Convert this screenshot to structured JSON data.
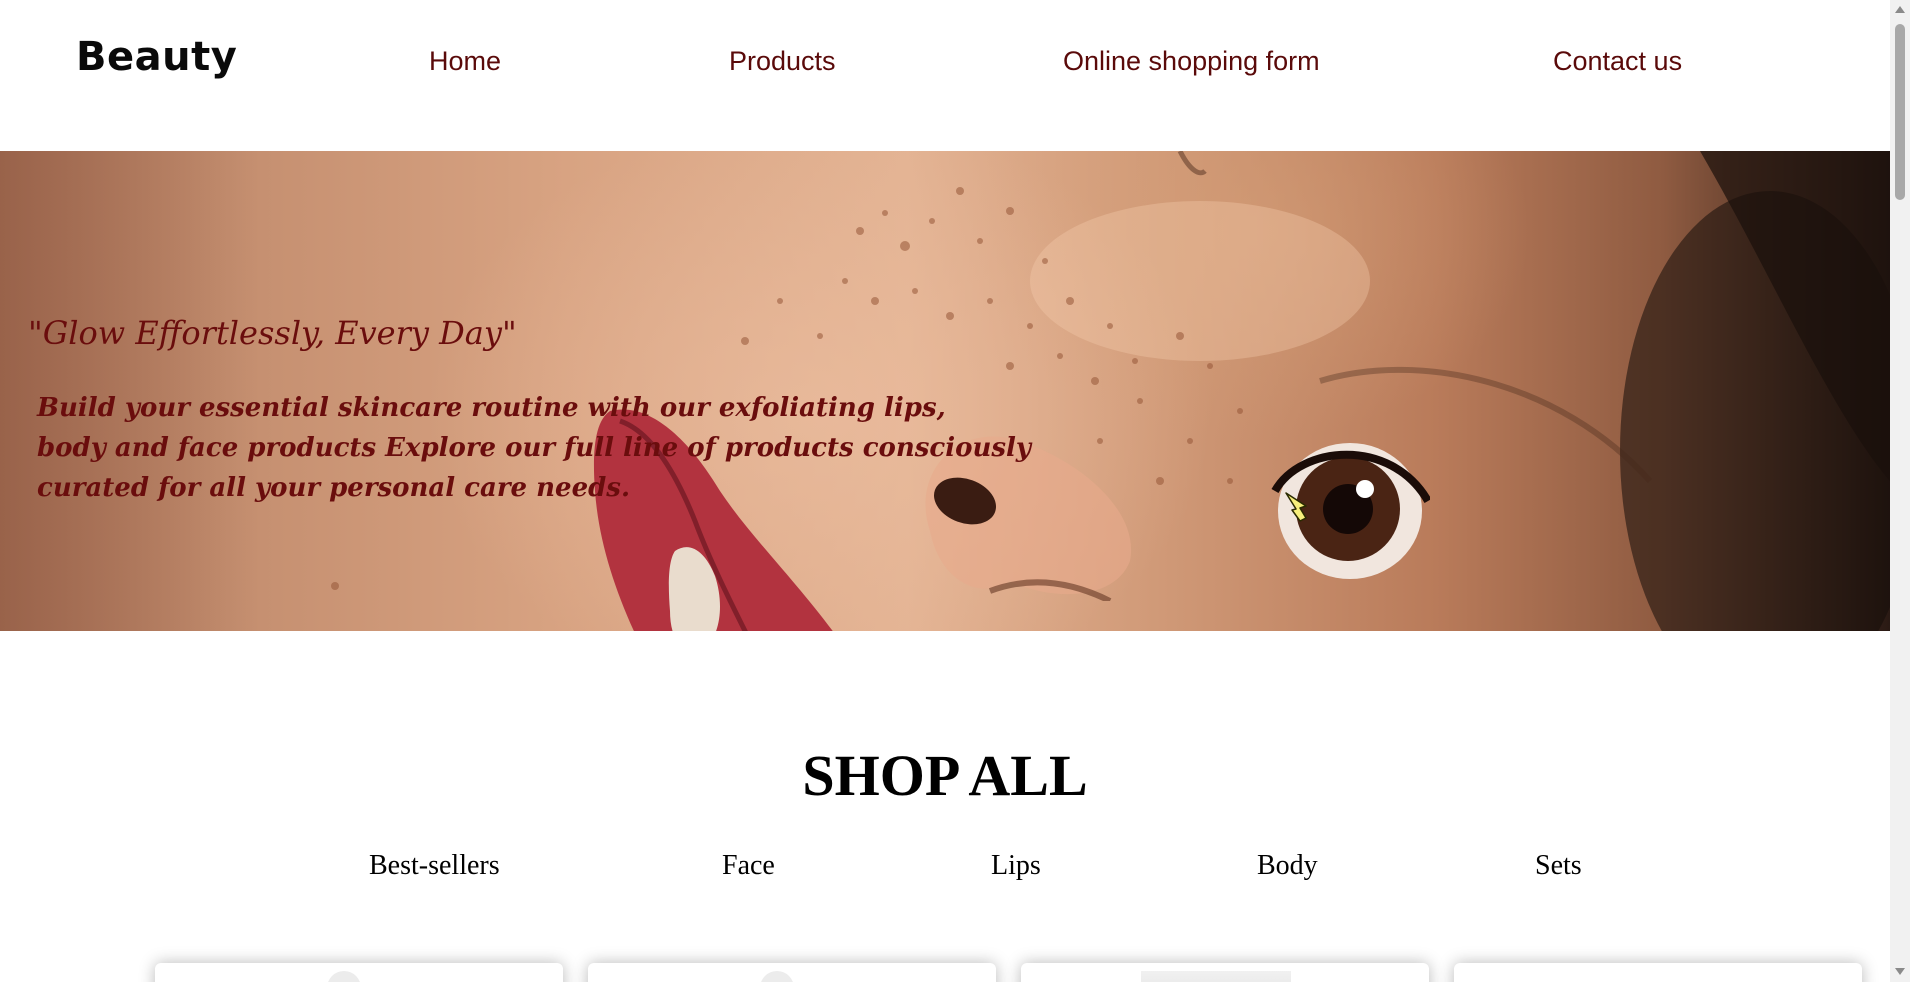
{
  "header": {
    "logo": "Beauty",
    "nav": {
      "home": "Home",
      "products": "Products",
      "form": "Online shopping form",
      "contact": "Contact us"
    }
  },
  "hero": {
    "tagline": "\"Glow Effortlessly, Every Day\"",
    "body_lines": [
      "Build your essential skincare routine with our exfoliating lips,",
      "body and face products Explore our full line of products consciously",
      "curated for all your personal care needs."
    ]
  },
  "shop": {
    "title": "SHOP ALL",
    "categories": {
      "best_sellers": "Best-sellers",
      "face": "Face",
      "lips": "Lips",
      "body": "Body",
      "sets": "Sets"
    }
  },
  "colors": {
    "nav_text": "#5a0a0a",
    "hero_text": "#6a0d0d",
    "logo_text": "#0a0a0a"
  },
  "icons": {
    "cursor": "hand-pointer-icon",
    "scroll_up": "scroll-up-arrow-icon",
    "scroll_down": "scroll-down-arrow-icon"
  }
}
